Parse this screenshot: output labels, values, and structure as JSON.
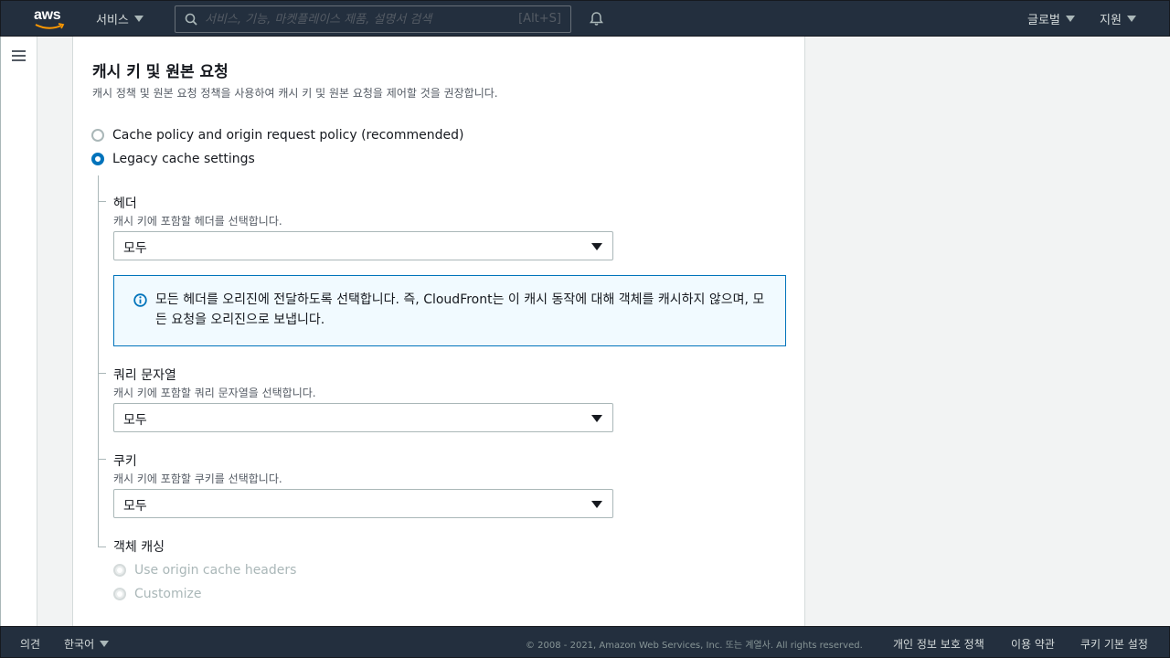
{
  "topnav": {
    "logo_text": "aws",
    "services_label": "서비스",
    "search_placeholder": "서비스, 기능, 마켓플레이스 제품, 설명서 검색",
    "search_shortcut": "[Alt+S]",
    "region_label": "글로벌",
    "support_label": "지원"
  },
  "section": {
    "title": "캐시 키 및 원본 요청",
    "description": "캐시 정책 및 원본 요청 정책을 사용하여 캐시 키 및 원본 요청을 제어할 것을 권장합니다.",
    "options": [
      {
        "label": "Cache policy and origin request policy (recommended)",
        "selected": false
      },
      {
        "label": "Legacy cache settings",
        "selected": true
      }
    ]
  },
  "headers": {
    "label": "헤더",
    "description": "캐시 키에 포함할 헤더를 선택합니다.",
    "value": "모두"
  },
  "alert": {
    "icon": "info-icon",
    "text": "모든 헤더를 오리진에 전달하도록 선택합니다. 즉, CloudFront는 이 캐시 동작에 대해 객체를 캐시하지 않으며, 모든 요청을 오리진으로 보냅니다."
  },
  "query_strings": {
    "label": "쿼리 문자열",
    "description": "캐시 키에 포함할 쿼리 문자열을 선택합니다.",
    "value": "모두"
  },
  "cookies": {
    "label": "쿠키",
    "description": "캐시 키에 포함할 쿠키를 선택합니다.",
    "value": "모두"
  },
  "object_caching": {
    "label": "객체 캐싱",
    "options": [
      {
        "label": "Use origin cache headers",
        "disabled": true
      },
      {
        "label": "Customize",
        "disabled": true
      }
    ]
  },
  "footer": {
    "feedback": "의견",
    "language": "한국어",
    "copyright": "© 2008 - 2021, Amazon Web Services, Inc. 또는 계열사. All rights reserved.",
    "privacy": "개인 정보 보호 정책",
    "terms": "이용 약관",
    "cookie_prefs": "쿠키 기본 설정"
  },
  "colors": {
    "nav_bg": "#232f3e",
    "accent": "#0073bb",
    "alert_bg": "#f1faff",
    "logo_smile": "#ff9900"
  }
}
